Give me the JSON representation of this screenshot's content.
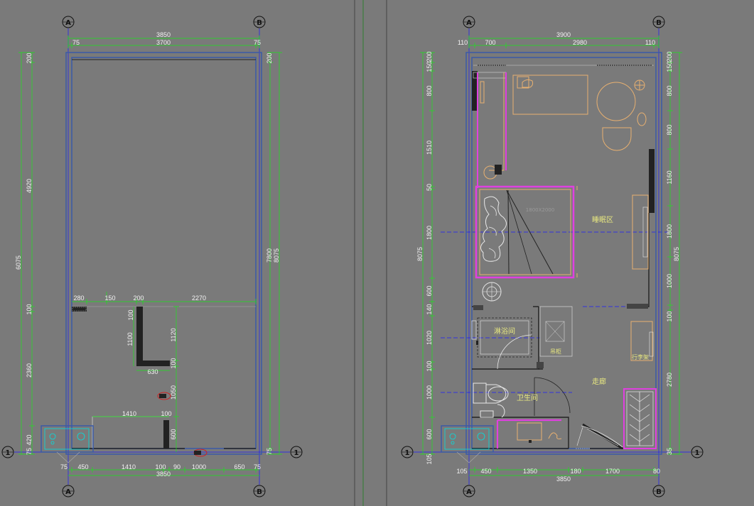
{
  "left_plan": {
    "axis_top": [
      "A",
      "B"
    ],
    "axis_bottom": [
      "A",
      "B"
    ],
    "axis_side": [
      "1",
      "1"
    ],
    "top_total": "3850",
    "top_parts": [
      "75",
      "3700",
      "75"
    ],
    "left_dims": [
      "200",
      "4920",
      "6075",
      "100",
      "2360",
      "420",
      "75"
    ],
    "right_dims": [
      "200",
      "7800",
      "8075",
      "75"
    ],
    "inner_top_dims": [
      "280",
      "150",
      "200",
      "2270"
    ],
    "wall_dims": [
      "100",
      "1100",
      "1120",
      "100",
      "630"
    ],
    "inner_lower_dims": [
      "1410",
      "100",
      "1050",
      "600"
    ],
    "bottom_parts": [
      "75",
      "450",
      "1410",
      "100",
      "90",
      "1000",
      "650",
      "75"
    ],
    "bottom_total": "3850"
  },
  "right_plan": {
    "axis_top": [
      "A",
      "B"
    ],
    "axis_bottom": [
      "A",
      "B"
    ],
    "axis_side": [
      "1",
      "1"
    ],
    "top_total": "3900",
    "top_parts": [
      "110",
      "700",
      "2980",
      "110"
    ],
    "left_dims": [
      "200",
      "150",
      "800",
      "1510",
      "50",
      "1800",
      "600",
      "140",
      "1020",
      "100",
      "1000",
      "600",
      "105"
    ],
    "left_total": "8075",
    "right_dims": [
      "200",
      "150",
      "800",
      "800",
      "1160",
      "1800",
      "1000",
      "100",
      "2780",
      "35"
    ],
    "right_total": "8075",
    "rooms": {
      "sleep": "睡眠区",
      "shower": "淋浴间",
      "toilet": "卫生间",
      "corridor": "走廊",
      "luggage": "行李架",
      "cabinet": "吊柜"
    },
    "bottom_parts": [
      "105",
      "450",
      "1350",
      "180",
      "1700",
      "80"
    ],
    "bottom_total": "3850"
  },
  "colors": {
    "background": "#7a7a7a",
    "wall": "#3a5aa8",
    "dimension": "#19e619",
    "axis_line": "#1a1aff",
    "furniture": "#e8b070",
    "fabric": "#e040e0",
    "fixture": "#00e0e0"
  }
}
